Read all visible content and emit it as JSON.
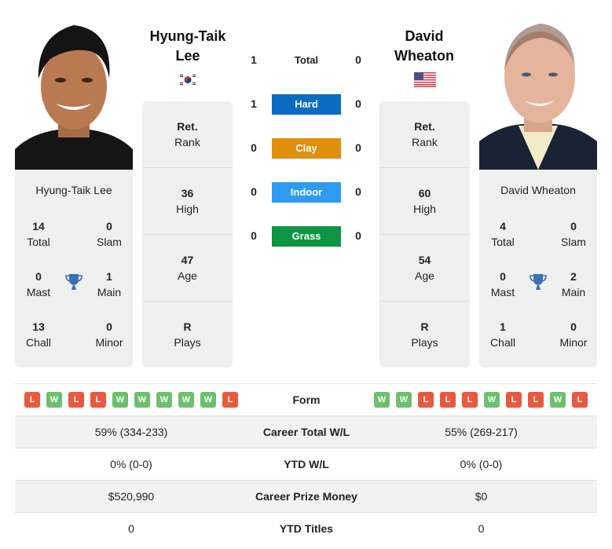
{
  "colors": {
    "hard": "#0b6cbf",
    "clay": "#e08e0b",
    "indoor": "#2e9bf0",
    "grass": "#0d9542",
    "win": "#6dbf6d",
    "loss": "#e9583f",
    "trophy": "#3b6fb6"
  },
  "player_left": {
    "name_line1": "Hyung-Taik",
    "name_line2": "Lee",
    "full_name": "Hyung-Taik Lee",
    "flag": "south-korea-flag",
    "titles": {
      "total": {
        "value": "14",
        "label": "Total"
      },
      "slam": {
        "value": "0",
        "label": "Slam"
      },
      "mast": {
        "value": "0",
        "label": "Mast"
      },
      "main": {
        "value": "1",
        "label": "Main"
      },
      "chall": {
        "value": "13",
        "label": "Chall"
      },
      "minor": {
        "value": "0",
        "label": "Minor"
      }
    },
    "info": {
      "rank": {
        "value": "Ret.",
        "label": "Rank"
      },
      "high": {
        "value": "36",
        "label": "High"
      },
      "age": {
        "value": "47",
        "label": "Age"
      },
      "plays": {
        "value": "R",
        "label": "Plays"
      }
    },
    "form": [
      "L",
      "W",
      "L",
      "L",
      "W",
      "W",
      "W",
      "W",
      "W",
      "L"
    ]
  },
  "player_right": {
    "name_line1": "David",
    "name_line2": "Wheaton",
    "full_name": "David Wheaton",
    "flag": "usa-flag",
    "titles": {
      "total": {
        "value": "4",
        "label": "Total"
      },
      "slam": {
        "value": "0",
        "label": "Slam"
      },
      "mast": {
        "value": "0",
        "label": "Mast"
      },
      "main": {
        "value": "2",
        "label": "Main"
      },
      "chall": {
        "value": "1",
        "label": "Chall"
      },
      "minor": {
        "value": "0",
        "label": "Minor"
      }
    },
    "info": {
      "rank": {
        "value": "Ret.",
        "label": "Rank"
      },
      "high": {
        "value": "60",
        "label": "High"
      },
      "age": {
        "value": "54",
        "label": "Age"
      },
      "plays": {
        "value": "R",
        "label": "Plays"
      }
    },
    "form": [
      "W",
      "W",
      "L",
      "L",
      "L",
      "W",
      "L",
      "L",
      "W",
      "L"
    ]
  },
  "h2h": {
    "total": {
      "label": "Total",
      "left": "1",
      "right": "0"
    },
    "hard": {
      "label": "Hard",
      "left": "1",
      "right": "0"
    },
    "clay": {
      "label": "Clay",
      "left": "0",
      "right": "0"
    },
    "indoor": {
      "label": "Indoor",
      "left": "0",
      "right": "0"
    },
    "grass": {
      "label": "Grass",
      "left": "0",
      "right": "0"
    }
  },
  "table": {
    "form_label": "Form",
    "rows": [
      {
        "label": "Career Total W/L",
        "left": "59% (334-233)",
        "right": "55% (269-217)"
      },
      {
        "label": "YTD W/L",
        "left": "0% (0-0)",
        "right": "0% (0-0)"
      },
      {
        "label": "Career Prize Money",
        "left": "$520,990",
        "right": "$0"
      },
      {
        "label": "YTD Titles",
        "left": "0",
        "right": "0"
      }
    ]
  }
}
